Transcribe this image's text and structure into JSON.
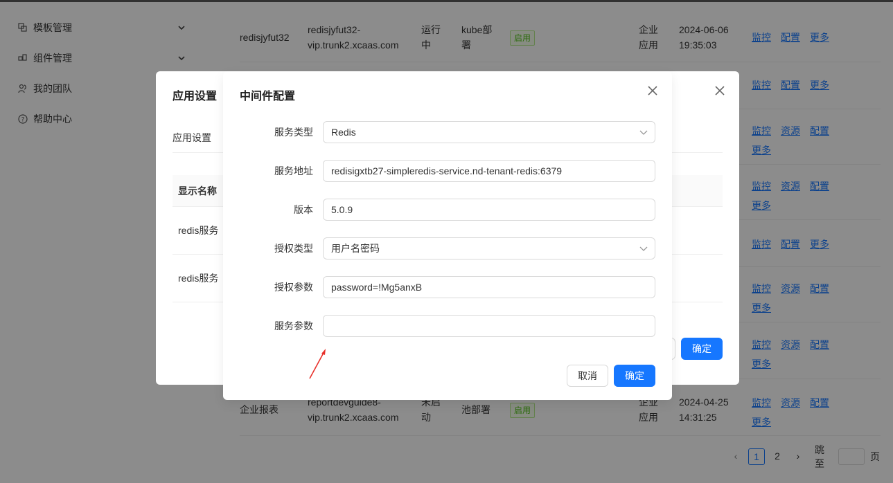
{
  "sidebar": {
    "items": [
      {
        "label": "模板管理",
        "icon": "template-icon",
        "has_chevron": true
      },
      {
        "label": "组件管理",
        "icon": "component-icon",
        "has_chevron": true
      },
      {
        "label": "我的团队",
        "icon": "team-icon",
        "has_chevron": false
      },
      {
        "label": "帮助中心",
        "icon": "help-icon",
        "has_chevron": false
      }
    ]
  },
  "table": {
    "rows": [
      {
        "name": "redisjyfut32",
        "addr": "redisjyfut32-vip.trunk2.xcaas.com",
        "status": "运行中",
        "deploy": "kube部署",
        "tag": "启用",
        "type": "企业应用",
        "time": "2024-06-06 19:35:03",
        "ops": [
          "监控",
          "配置",
          "更多"
        ]
      },
      {
        "ops": [
          "监控",
          "配置",
          "更多"
        ]
      },
      {
        "ops": [
          "监控",
          "资源",
          "配置",
          "更多"
        ]
      },
      {
        "ops": [
          "监控",
          "资源",
          "配置",
          "更多"
        ]
      },
      {
        "ops": [
          "监控",
          "配置",
          "更多"
        ]
      },
      {
        "ops": [
          "监控",
          "资源",
          "配置",
          "更多"
        ]
      },
      {
        "ops": [
          "监控",
          "资源",
          "配置",
          "更多"
        ]
      },
      {
        "name": "企业报表",
        "addr": "reportdevguide8-vip.trunk2.xcaas.com",
        "status": "未启动",
        "deploy": "池部署",
        "tag": "启用",
        "type": "企业应用",
        "time": "2024-04-25 14:31:25",
        "ops": [
          "监控",
          "资源",
          "配置",
          "更多"
        ]
      }
    ]
  },
  "pagination": {
    "prev": "‹",
    "page1": "1",
    "page2": "2",
    "next": "›",
    "jump_label": "跳至",
    "page_suffix": "页"
  },
  "back_modal": {
    "title": "应用设置",
    "tab": "应用设置",
    "column_header": "显示名称",
    "rows": [
      "redis服务",
      "redis服务"
    ],
    "ok_label": "确定"
  },
  "modal": {
    "title": "中间件配置",
    "fields": {
      "service_type": {
        "label": "服务类型",
        "value": "Redis"
      },
      "service_addr": {
        "label": "服务地址",
        "value": "redisigxtb27-simpleredis-service.nd-tenant-redis:6379"
      },
      "version": {
        "label": "版本",
        "value": "5.0.9"
      },
      "auth_type": {
        "label": "授权类型",
        "value": "用户名密码"
      },
      "auth_params": {
        "label": "授权参数",
        "value": "password=!Mg5anxB"
      },
      "service_params": {
        "label": "服务参数",
        "value": ""
      }
    },
    "cancel_label": "取消",
    "ok_label": "确定"
  },
  "colors": {
    "primary": "#1677ff",
    "success": "#52c41a",
    "annotation": "#e8302a"
  }
}
